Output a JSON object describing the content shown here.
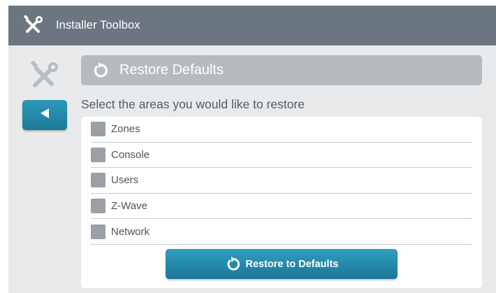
{
  "app": {
    "title": "Installer Toolbox",
    "icon": "tools-icon"
  },
  "sidebar": {
    "tools_icon": "tools-icon",
    "back_icon": "back-arrow-icon"
  },
  "header": {
    "title": "Restore Defaults",
    "icon": "restore-icon"
  },
  "instructions": "Select the areas you would like to restore",
  "areas": [
    {
      "label": "Zones",
      "checked": false
    },
    {
      "label": "Console",
      "checked": false
    },
    {
      "label": "Users",
      "checked": false
    },
    {
      "label": "Z-Wave",
      "checked": false
    },
    {
      "label": "Network",
      "checked": false
    }
  ],
  "restore_button": {
    "label": "Restore to Defaults",
    "icon": "restore-icon"
  },
  "colors": {
    "titlebar": "#6c7680",
    "background": "#e9eaeb",
    "accent": "#2590b1",
    "header_bar": "#b6bbc0",
    "checkbox": "#9aa0a6"
  }
}
